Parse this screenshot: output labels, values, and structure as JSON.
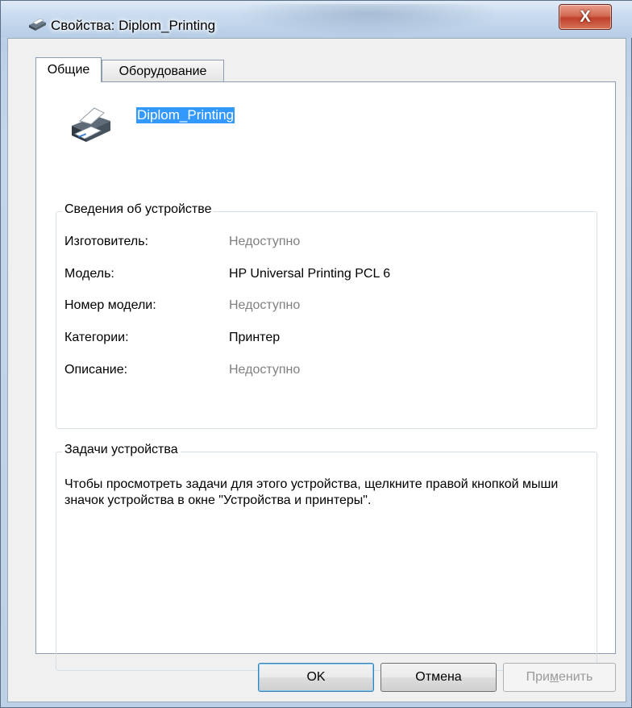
{
  "window": {
    "title": "Свойства: Diplom_Printing",
    "close_glyph": "X"
  },
  "tabs": [
    {
      "label": "Общие",
      "active": true
    },
    {
      "label": "Оборудование",
      "active": false
    }
  ],
  "device": {
    "name": "Diplom_Printing",
    "icon": "printer-icon"
  },
  "info_group": {
    "title": "Сведения об устройстве",
    "rows": [
      {
        "label": "Изготовитель:",
        "value": "Недоступно",
        "available": false
      },
      {
        "label": "Модель:",
        "value": "HP Universal Printing PCL 6",
        "available": true
      },
      {
        "label": "Номер модели:",
        "value": "Недоступно",
        "available": false
      },
      {
        "label": "Категории:",
        "value": "Принтер",
        "available": true
      },
      {
        "label": "Описание:",
        "value": "Недоступно",
        "available": false
      }
    ]
  },
  "tasks_group": {
    "title": "Задачи устройства",
    "text": "Чтобы просмотреть задачи для этого устройства, щелкните правой кнопкой мыши значок устройства в окне \"Устройства и принтеры\"."
  },
  "buttons": {
    "ok": "OK",
    "cancel": "Отмена",
    "apply_prefix": "При",
    "apply_mnemonic": "м",
    "apply_suffix": "енить"
  },
  "colors": {
    "selection": "#3399ff",
    "unavailable_text": "#808080",
    "close_button": "#c0412a"
  }
}
